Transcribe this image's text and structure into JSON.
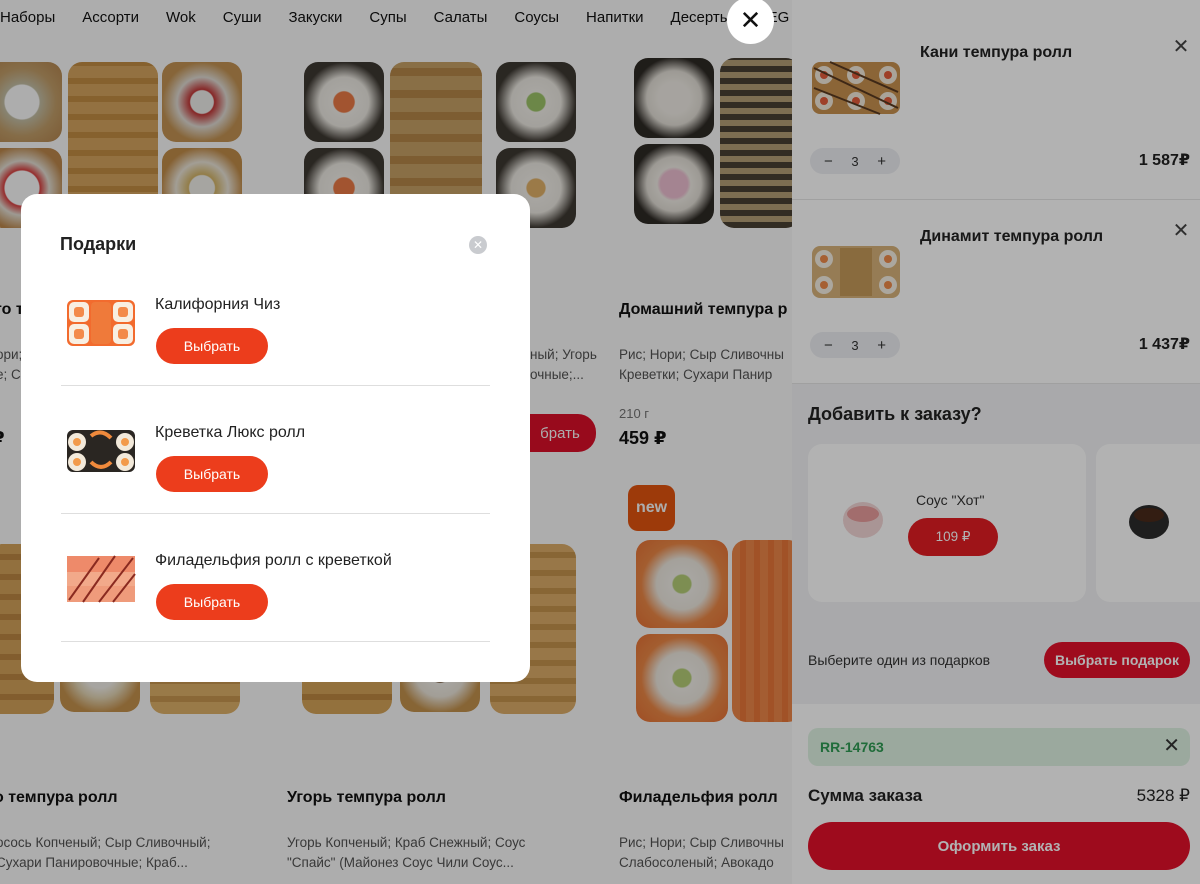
{
  "categories": [
    "Наборы",
    "Ассорти",
    "Wok",
    "Суши",
    "Закуски",
    "Супы",
    "Салаты",
    "Соусы",
    "Напитки",
    "Десерты",
    "VEG"
  ],
  "products": [
    {
      "title": "то т",
      "desc1": "ори;",
      "desc2": "е; С",
      "price": "₽"
    },
    {
      "title": "",
      "desc1": "ный; Угорь",
      "desc2": "очные;...",
      "button": "брать"
    },
    {
      "title": "Домашний темпура р",
      "desc1": "Рис; Нори; Сыр Сливочны",
      "desc2": "Креветки; Сухари Панир",
      "weight": "210 г",
      "price": "459 ₽"
    },
    {
      "title": "о темпура ролл",
      "desc1": "осось Копченый; Сыр Сливочный;",
      "desc2": "Сухари Панировочные; Краб..."
    },
    {
      "title": "Угорь темпура ролл",
      "desc1": "Угорь Копченый; Краб Снежный; Соус",
      "desc2": "\"Спайс\" (Майонез Соус Чили Соус..."
    },
    {
      "title": "Филадельфия ролл",
      "desc1": "Рис; Нори; Сыр Сливочны",
      "desc2": "Слабосоленый; Авокадо",
      "badge": "new"
    }
  ],
  "cart": {
    "items": [
      {
        "name": "Кани темпура ролл",
        "qty": "3",
        "price": "1 587₽"
      },
      {
        "name": "Динамит темпура ролл",
        "qty": "3",
        "price": "1 437₽"
      }
    ],
    "stepper_minus": "−",
    "stepper_plus": "+",
    "remove_glyph": "✕",
    "upsell_title": "Добавить к заказу?",
    "upsell": [
      {
        "name": "Соус \"Хот\"",
        "price": "109 ₽"
      }
    ],
    "gift_hint": "Выберите один из подарков",
    "gift_button": "Выбрать подарок",
    "promo_code": "RR-14763",
    "promo_remove": "✕",
    "sum_label": "Сумма заказа",
    "sum_value": "5328 ₽",
    "checkout": "Оформить заказ"
  },
  "drawer_close": "✕",
  "modal": {
    "title": "Подарки",
    "close": "✕",
    "gifts": [
      {
        "name": "Калифорния Чиз",
        "button": "Выбрать"
      },
      {
        "name": "Креветка Люкс ролл",
        "button": "Выбрать"
      },
      {
        "name": "Филадельфия ролл с креветкой",
        "button": "Выбрать"
      }
    ]
  },
  "colors": {
    "accent": "#e3112a",
    "pick": "#ec3d1c",
    "promo_bg": "#def3e3",
    "promo_text": "#2f9b53",
    "badge_new": "#e8560f"
  }
}
